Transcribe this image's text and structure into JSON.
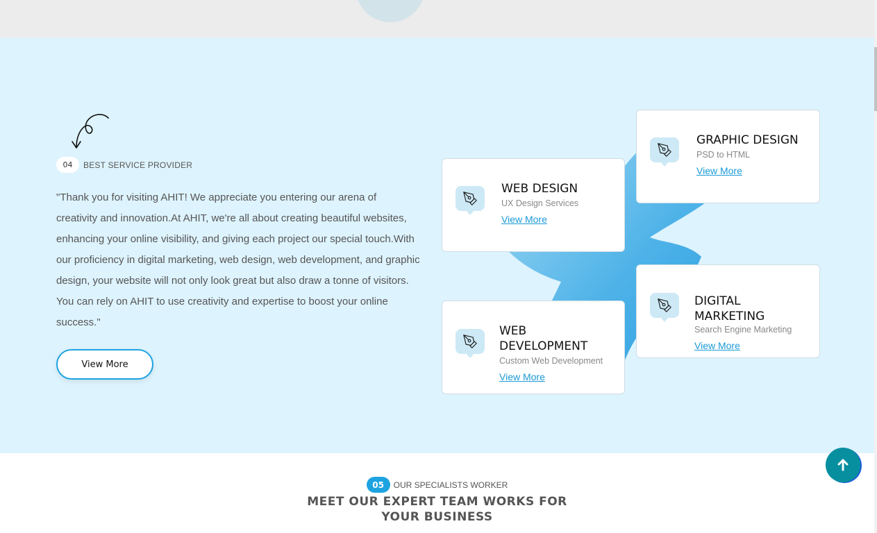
{
  "services": {
    "kicker_number": "04",
    "kicker_label": "BEST SERVICE PROVIDER",
    "intro": "\"Thank you for visiting AHIT! We appreciate you entering our arena of creativity and innovation.At AHIT, we're all about creating beautiful websites, enhancing your online visibility, and giving each project our special touch.With our proficiency in digital marketing, web design, web development, and graphic design, your website will not only look great but also draw a tonne of visitors. You can rely on AHIT to use creativity and expertise to boost your online success.\"",
    "view_more_label": "View More",
    "cards": [
      {
        "title": "WEB DESIGN",
        "subtitle": "UX Design Services",
        "link": "View More",
        "icon": "pen-tool-icon"
      },
      {
        "title": "GRAPHIC DESIGN",
        "subtitle": "PSD to HTML",
        "link": "View More",
        "icon": "pen-tool-icon"
      },
      {
        "title_line1": "WEB",
        "title_line2": "DEVELOPMENT",
        "subtitle": "Custom Web Development",
        "link": "View More",
        "icon": "pen-tool-icon"
      },
      {
        "title_line1": "DIGITAL",
        "title_line2": "MARKETING",
        "subtitle": "Search Engine Marketing",
        "link": "View More",
        "icon": "pen-tool-icon"
      }
    ]
  },
  "team": {
    "kicker_number": "05",
    "kicker_label": "OUR SPECIALISTS WORKER",
    "title_line1": "MEET OUR EXPERT TEAM WORKS FOR",
    "title_line2": "YOUR BUSINESS"
  },
  "scroll_top_icon": "arrow-up-icon",
  "colors": {
    "accent": "#1da3e0",
    "section_bg": "#ddf3fd",
    "scroll_top_bg": "#078f9f"
  }
}
